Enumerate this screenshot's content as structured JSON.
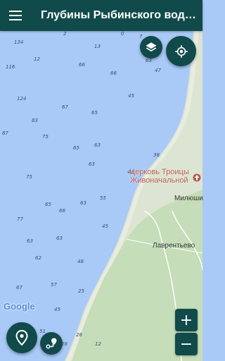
{
  "app_bar": {
    "title": "Глубины Рыбинского водохранилища"
  },
  "map": {
    "depths": [
      "2",
      "134",
      "13",
      "0",
      "7",
      "12",
      "66",
      "66",
      "47",
      "63",
      "116",
      "45",
      "124",
      "67",
      "65",
      "83",
      "87",
      "75",
      "65",
      "63",
      "38",
      "63",
      "75",
      "44",
      "55",
      "65",
      "66",
      "63",
      "77",
      "45",
      "63",
      "63",
      "62",
      "48",
      "67",
      "57",
      "25",
      "45",
      "28",
      "51",
      "28",
      "12"
    ],
    "places": {
      "church_line1": "Церковь Троицы",
      "church_line2": "Живоначальной",
      "milyushino": "Милюши",
      "lavrentevo": "Лаврентьево"
    },
    "attribution": "Google"
  },
  "controls": {
    "zoom_in": "+",
    "zoom_out": "−"
  },
  "icons": {
    "menu": "menu-icon",
    "layers": "layers-icon",
    "locate": "my-location-icon",
    "pin": "map-pin-icon",
    "route": "route-icon"
  },
  "colors": {
    "toolbar": "#114a4a",
    "water": "#a9c9f7",
    "land": "#dce4d2",
    "forest": "#c5ddb8"
  }
}
